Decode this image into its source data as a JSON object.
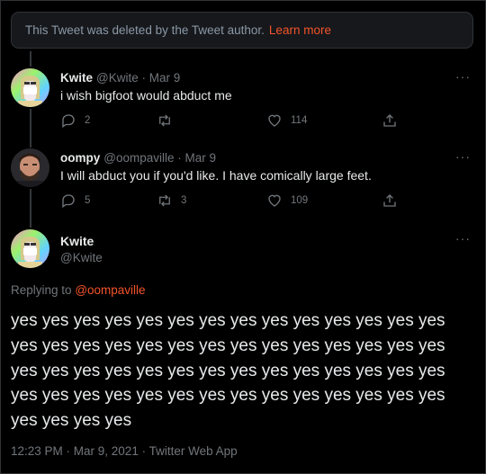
{
  "deleted_notice": {
    "text": "This Tweet was deleted by the Tweet author.",
    "link": "Learn more"
  },
  "tweets": [
    {
      "name": "Kwite",
      "handle": "@Kwite",
      "date": "Mar 9",
      "text": "i wish bigfoot would abduct me",
      "replies": "2",
      "retweets": "",
      "likes": "114"
    },
    {
      "name": "oompy",
      "handle": "@oompaville",
      "date": "Mar 9",
      "text": "I will abduct you if you'd like. I have comically large feet.",
      "replies": "5",
      "retweets": "3",
      "likes": "109"
    }
  ],
  "main_tweet": {
    "name": "Kwite",
    "handle": "@Kwite",
    "replying_prefix": "Replying to",
    "replying_to": "@oompaville",
    "text": "yes yes yes yes yes yes yes yes yes yes yes yes yes yes yes yes yes yes yes yes yes yes yes yes yes yes yes yes yes yes yes yes yes yes yes yes yes yes yes yes yes yes yes yes yes yes yes yes yes yes yes yes yes yes yes yes yes yes yes yes",
    "timestamp": "12:23 PM · Mar 9, 2021 · ",
    "source": "Twitter Web App"
  },
  "more_glyph": "···",
  "icons": {
    "reply": "reply-icon",
    "retweet": "retweet-icon",
    "like": "heart-icon",
    "share": "share-icon"
  },
  "colors": {
    "background": "#000000",
    "accent": "#f4542a",
    "muted": "#71767b",
    "text": "#e7e9ea"
  }
}
